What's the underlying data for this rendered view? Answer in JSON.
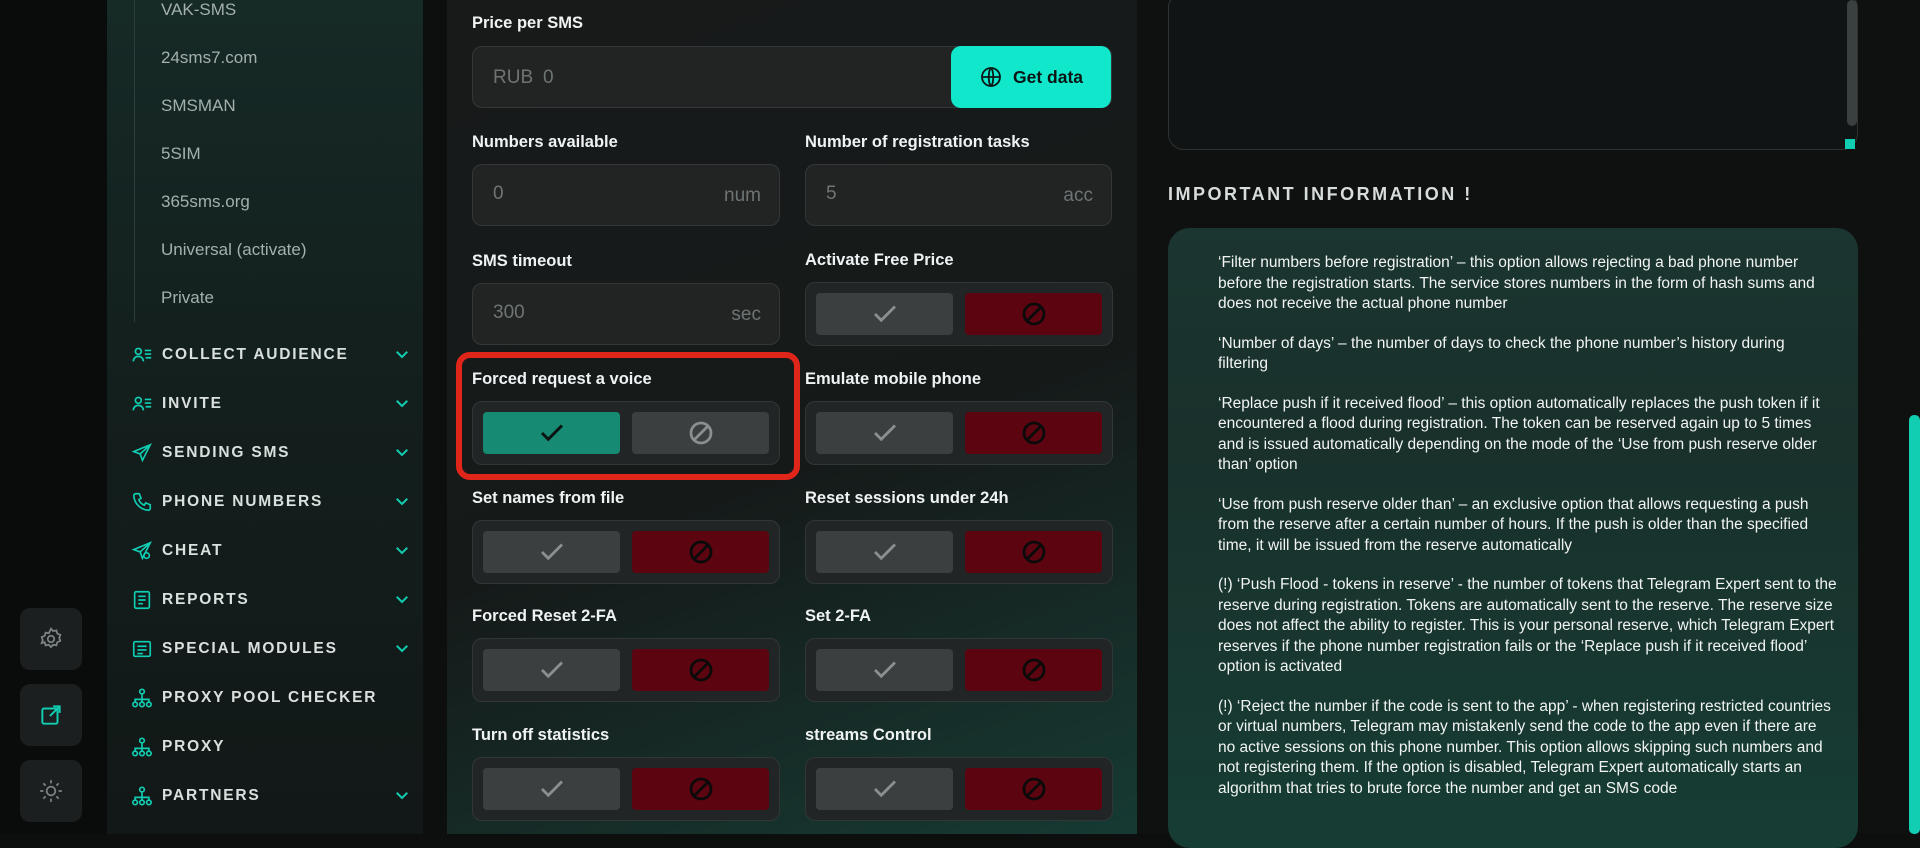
{
  "sidebar": {
    "sub_items": [
      "VAK-SMS",
      "24sms7.com",
      "SMSMAN",
      "5SIM",
      "365sms.org",
      "Universal (activate)",
      "Private"
    ],
    "nav": [
      {
        "label": "COLLECT AUDIENCE",
        "icon": "users-icon",
        "has_chevron": true
      },
      {
        "label": "INVITE",
        "icon": "users-icon",
        "has_chevron": true
      },
      {
        "label": "SENDING SMS",
        "icon": "send-icon",
        "has_chevron": true
      },
      {
        "label": "PHONE NUMBERS",
        "icon": "phone-icon",
        "has_chevron": true
      },
      {
        "label": "CHEAT",
        "icon": "send-icon",
        "has_chevron": true
      },
      {
        "label": "REPORTS",
        "icon": "report-icon",
        "has_chevron": true
      },
      {
        "label": "SPECIAL MODULES",
        "icon": "report-icon",
        "has_chevron": true
      },
      {
        "label": "PROXY POOL CHECKER",
        "icon": "network-icon",
        "has_chevron": false
      },
      {
        "label": "PROXY",
        "icon": "network-icon",
        "has_chevron": false
      },
      {
        "label": "PARTNERS",
        "icon": "network-icon",
        "has_chevron": true
      }
    ]
  },
  "rail": {
    "icons": [
      "gear-icon",
      "external-link-icon",
      "sun-icon"
    ]
  },
  "form": {
    "price": {
      "label": "Price per SMS",
      "currency": "RUB",
      "value": "0",
      "button": "Get data"
    },
    "numbers_available": {
      "label": "Numbers available",
      "value": "0",
      "unit": "num"
    },
    "registration_tasks": {
      "label": "Number of registration tasks",
      "value": "5",
      "unit": "acc"
    },
    "sms_timeout": {
      "label": "SMS timeout",
      "value": "300",
      "unit": "sec"
    },
    "toggles": [
      {
        "label": "Activate Free Price",
        "enabled": false
      },
      {
        "label": "Forced request a voice",
        "enabled": true
      },
      {
        "label": "Emulate mobile phone",
        "enabled": false
      },
      {
        "label": "Set names from file",
        "enabled": false
      },
      {
        "label": "Reset sessions under 24h",
        "enabled": false
      },
      {
        "label": "Forced Reset 2-FA",
        "enabled": false
      },
      {
        "label": "Set 2-FA",
        "enabled": false
      },
      {
        "label": "Turn off statistics",
        "enabled": false
      },
      {
        "label": "streams Control",
        "enabled": false
      }
    ]
  },
  "info": {
    "title": "IMPORTANT INFORMATION !",
    "paragraphs": [
      "‘Filter numbers before registration’ – this option allows rejecting a bad phone number before the registration starts. The service stores numbers in the form of hash sums and does not receive the actual phone number",
      "‘Number of days’ – the number of days to check the phone number’s history during filtering",
      "‘Replace push if it received flood’ – this option automatically replaces the push token if it encountered a flood during registration. The token can be reserved again up to 5 times and is issued automatically depending on the mode of the ‘Use from push reserve older than’ option",
      "‘Use from push reserve older than’ – an exclusive option that allows requesting a push from the reserve after a certain number of hours. If the push is older than the specified time, it will be issued from the reserve automatically",
      "(!) ‘Push Flood - tokens in reserve’ - the number of tokens that Telegram Expert sent to the reserve during registration. Tokens are automatically sent to the reserve. The reserve size does not affect the ability to register. This is your personal reserve, which Telegram Expert reserves if the phone number registration fails or the ‘Replace push if it received flood’ option is activated",
      "(!) ‘Reject the number if the code is sent to the app’ - when registering restricted countries or virtual numbers, Telegram may mistakenly send the code to the app even if there are no active sessions on this phone number. This option allows skipping such numbers and not registering them. If the option is disabled, Telegram Expert automatically starts an algorithm that tries to brute force the number and get an SMS code"
    ]
  },
  "colors": {
    "accent": "#10e7cb",
    "toggle_on": "#168a72",
    "toggle_off_red": "#5c040f",
    "highlight": "#e0251b"
  }
}
